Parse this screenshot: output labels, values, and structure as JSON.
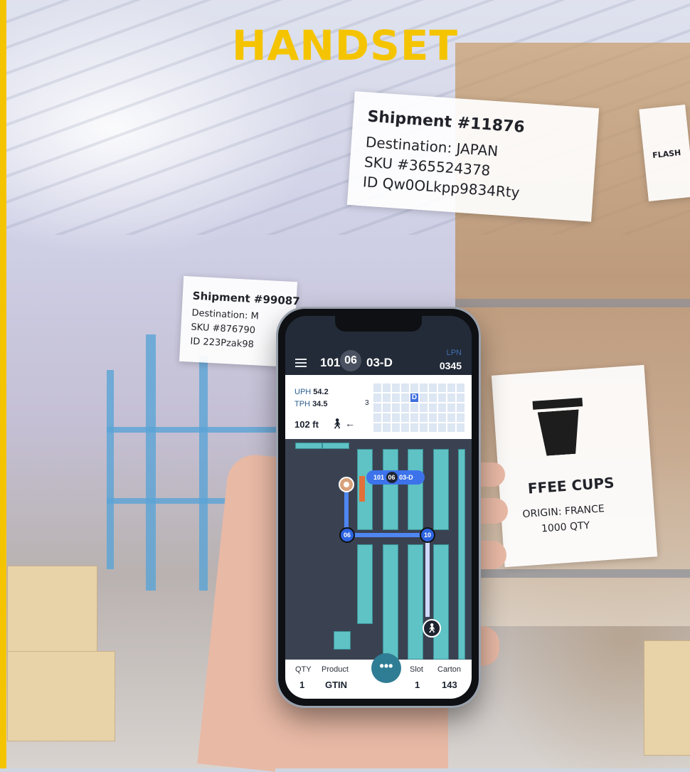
{
  "headline": "HANDSET",
  "signs": {
    "main": [
      "Shipment #11876",
      "Destination: JAPAN",
      "SKU #365524378",
      "ID Qw0OLkpp9834Rty"
    ],
    "left": [
      "Shipment #99087",
      "Destination: M",
      "SKU #876790",
      "ID 223Pzak98"
    ],
    "coffee": [
      "FFEE CUPS",
      "ORIGIN: FRANCE",
      "1000 QTY"
    ],
    "small_flash": [
      "FLASH"
    ]
  },
  "app": {
    "location": {
      "aisle": "101",
      "bay": "06",
      "slot": "03-D"
    },
    "lpn": {
      "label": "LPN",
      "value": "0345"
    },
    "stats": {
      "uph_label": "UPH",
      "uph": "54.2",
      "tph_label": "TPH",
      "tph": "34.5"
    },
    "distance": "102 ft",
    "grid": {
      "row_label": "3",
      "active_cell": "D"
    },
    "map": {
      "pill": {
        "aisle": "101",
        "bay": "06",
        "slot": "03-D"
      },
      "node_a": "06",
      "node_b": "10"
    },
    "fab_label": "•••",
    "bottom": [
      {
        "label": "QTY",
        "value": "1"
      },
      {
        "label": "Product",
        "value": "GTIN"
      },
      {
        "label": "Slot",
        "value": "1"
      },
      {
        "label": "Carton",
        "value": "143"
      }
    ]
  }
}
